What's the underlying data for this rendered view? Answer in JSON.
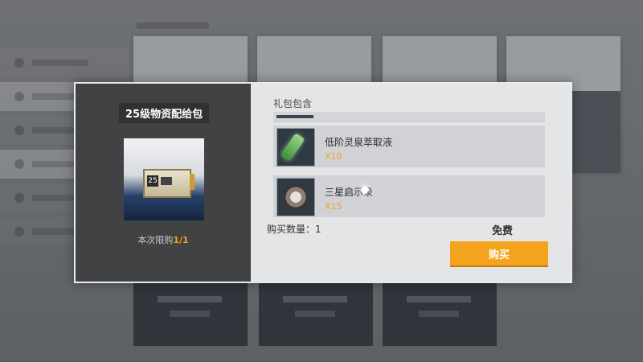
{
  "modal": {
    "pack_title": "25级物资配给包",
    "pack_level_badge": "25",
    "limit_label": "本次限购",
    "limit_count": "1/1",
    "contents_title": "礼包包含",
    "items": [
      {
        "name": "低阶灵泉萃取液",
        "qty": "X10",
        "icon": "vial-icon"
      },
      {
        "name": "三星启示录",
        "qty": "X15",
        "icon": "book-icon"
      }
    ],
    "buy_quantity": "购买数量：1",
    "price": "免费",
    "buy_button_label": "购买"
  },
  "colors": {
    "accent_orange": "#f4a31c",
    "quantity_text": "#f2a31b",
    "left_panel": "#414244",
    "right_panel": "#e4e5e7"
  }
}
